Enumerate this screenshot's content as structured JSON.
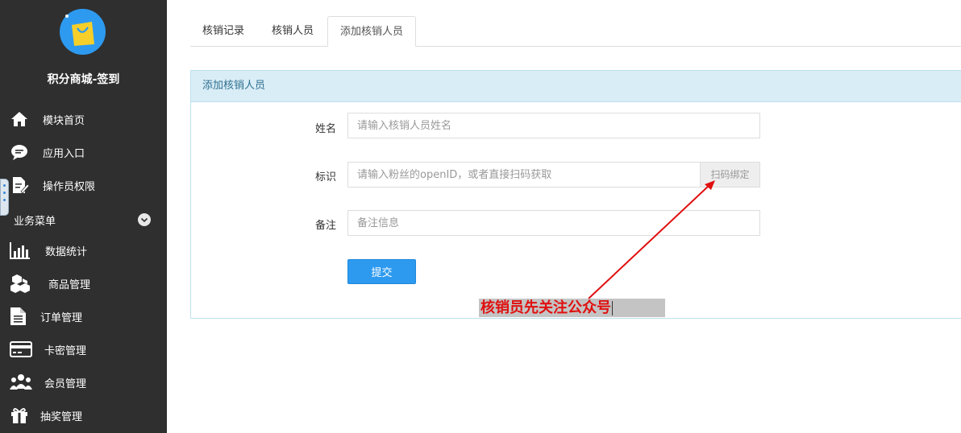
{
  "app": {
    "title": "积分商城-签到"
  },
  "sidebar": {
    "items": [
      {
        "label": "模块首页",
        "icon": "home-icon"
      },
      {
        "label": "应用入口",
        "icon": "chat-bubble-icon"
      },
      {
        "label": "操作员权限",
        "icon": "document-edit-icon"
      }
    ],
    "section": {
      "label": "业务菜单"
    },
    "sub_items": [
      {
        "label": "数据统计",
        "icon": "bar-chart-icon"
      },
      {
        "label": "商品管理",
        "icon": "cubes-icon"
      },
      {
        "label": "订单管理",
        "icon": "document-icon"
      },
      {
        "label": "卡密管理",
        "icon": "credit-card-icon"
      },
      {
        "label": "会员管理",
        "icon": "users-icon"
      },
      {
        "label": "抽奖管理",
        "icon": "gift-icon"
      }
    ]
  },
  "tabs": [
    {
      "label": "核销记录"
    },
    {
      "label": "核销人员"
    },
    {
      "label": "添加核销人员",
      "active": true
    }
  ],
  "panel": {
    "heading": "添加核销人员",
    "fields": {
      "name": {
        "label": "姓名",
        "placeholder": "请输入核销人员姓名",
        "value": ""
      },
      "identifier": {
        "label": "标识",
        "placeholder": "请输入粉丝的openID，或者直接扫码获取",
        "value": "",
        "addon": "扫码绑定"
      },
      "remark": {
        "label": "备注",
        "placeholder": "备注信息",
        "value": ""
      }
    },
    "submit_label": "提交"
  },
  "annotation": {
    "text": "核销员先关注公众号"
  },
  "colors": {
    "sidebar_bg": "#2f2f2f",
    "accent": "#2d9af0",
    "panel_heading_bg": "#d9edf7",
    "annotation_text": "#e01010"
  }
}
